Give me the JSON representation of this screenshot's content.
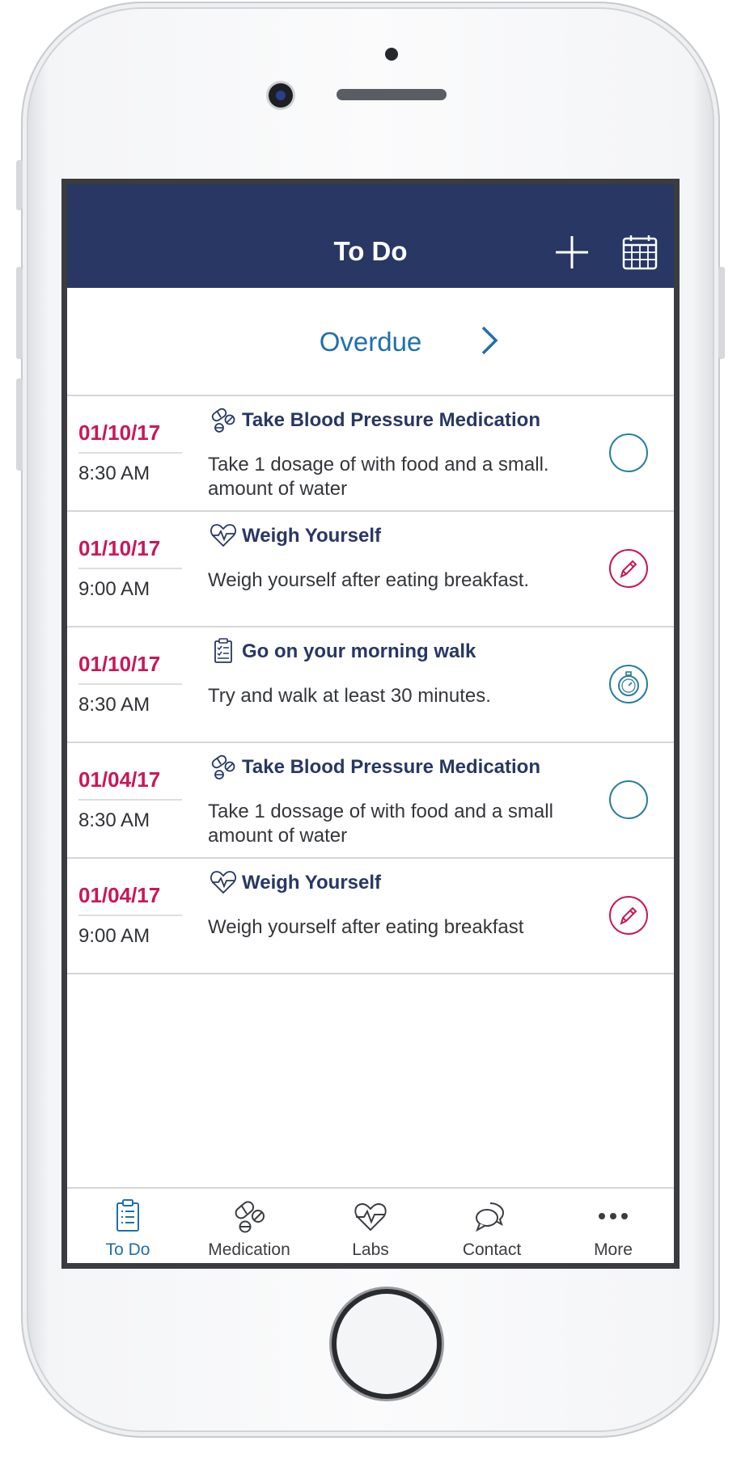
{
  "header": {
    "title": "To Do",
    "add_icon": "plus-icon",
    "calendar_icon": "calendar-icon"
  },
  "overdue": {
    "label": "Overdue",
    "icon": "chevron-right-icon"
  },
  "tasks": [
    {
      "date": "01/10/17",
      "time": "8:30 AM",
      "icon": "pills-icon",
      "title": "Take Blood Pressure Medication",
      "description": "Take 1 dosage of with food and a small. amount of water",
      "action": "empty-circle-icon"
    },
    {
      "date": "01/10/17",
      "time": "9:00 AM",
      "icon": "heartbeat-icon",
      "title": "Weigh Yourself",
      "description": "Weigh yourself after eating breakfast.",
      "action": "pencil-circle-icon"
    },
    {
      "date": "01/10/17",
      "time": "8:30 AM",
      "icon": "clipboard-icon",
      "title": "Go on your morning walk",
      "description": "Try and walk at least 30 minutes.",
      "action": "stopwatch-icon"
    },
    {
      "date": "01/04/17",
      "time": "8:30 AM",
      "icon": "pills-icon",
      "title": "Take Blood Pressure Medication",
      "description": "Take 1 dossage of with food and a small amount of water",
      "action": "empty-circle-icon"
    },
    {
      "date": "01/04/17",
      "time": "9:00 AM",
      "icon": "heartbeat-icon",
      "title": "Weigh Yourself",
      "description": "Weigh yourself after eating breakfast",
      "action": "pencil-circle-icon"
    }
  ],
  "tabs": [
    {
      "label": "To Do",
      "icon": "clipboard-icon",
      "active": true
    },
    {
      "label": "Medication",
      "icon": "pills-icon",
      "active": false
    },
    {
      "label": "Labs",
      "icon": "heartbeat-icon",
      "active": false
    },
    {
      "label": "Contact",
      "icon": "chat-bubbles-icon",
      "active": false
    },
    {
      "label": "More",
      "icon": "more-dots-icon",
      "active": false
    }
  ],
  "colors": {
    "header_bg": "#283763",
    "accent_blue": "#1f6fad",
    "date_red": "#c8175b",
    "teal": "#2a7f9c"
  }
}
